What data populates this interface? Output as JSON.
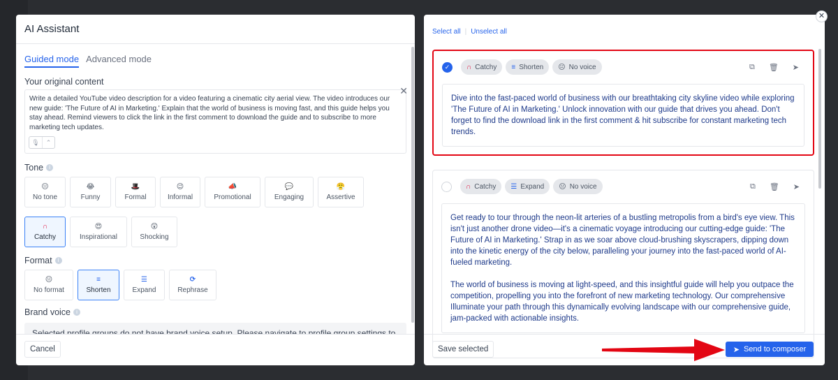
{
  "left": {
    "title": "AI Assistant",
    "modes": [
      "Guided mode",
      "Advanced mode"
    ],
    "original_label": "Your original content",
    "original_text": "Write a detailed YouTube video description for a video featuring a cinematic city aerial view. The video introduces our new guide: 'The Future of AI in Marketing.' Explain that the world of business is moving fast, and this guide helps you stay ahead. Remind viewers to click the link in the first comment to download the guide and to subscribe to more marketing tech updates.",
    "tone_label": "Tone",
    "tones": [
      {
        "label": "No tone",
        "icon": "😐"
      },
      {
        "label": "Funny",
        "icon": "😂"
      },
      {
        "label": "Formal",
        "icon": "🎩"
      },
      {
        "label": "Informal",
        "icon": "😉"
      },
      {
        "label": "Promotional",
        "icon": "📣"
      },
      {
        "label": "Engaging",
        "icon": "💬"
      },
      {
        "label": "Assertive",
        "icon": "😤"
      },
      {
        "label": "Catchy",
        "icon": "∩"
      },
      {
        "label": "Inspirational",
        "icon": "😍"
      },
      {
        "label": "Shocking",
        "icon": "😲"
      }
    ],
    "format_label": "Format",
    "formats": [
      {
        "label": "No format",
        "icon": "😐"
      },
      {
        "label": "Shorten",
        "icon": "≡"
      },
      {
        "label": "Expand",
        "icon": "☰"
      },
      {
        "label": "Rephrase",
        "icon": "⟳"
      }
    ],
    "brand_label": "Brand voice",
    "brand_note": "Selected profile groups do not have brand voice setup. Please navigate to profile group settings to",
    "cancel": "Cancel"
  },
  "right": {
    "select_all": "Select all",
    "unselect_all": "Unselect all",
    "cards": [
      {
        "tags": [
          {
            "label": "Catchy",
            "icon": "∩"
          },
          {
            "label": "Shorten",
            "icon": "≡"
          },
          {
            "label": "No voice",
            "icon": "😐"
          }
        ],
        "paragraphs": [
          "Dive into the fast-paced world of business with our breathtaking city skyline video while exploring 'The Future of AI in Marketing.' Unlock innovation with our guide that drives you ahead. Don't forget to find the download link in the first comment & hit subscribe for constant marketing tech trends."
        ]
      },
      {
        "tags": [
          {
            "label": "Catchy",
            "icon": "∩"
          },
          {
            "label": "Expand",
            "icon": "☰"
          },
          {
            "label": "No voice",
            "icon": "😐"
          }
        ],
        "paragraphs": [
          "Get ready to tour through the neon-lit arteries of a bustling metropolis from a bird's eye view. This isn't just another drone video—it's a cinematic voyage introducing our cutting-edge guide: 'The Future of AI in Marketing.' Strap in as we soar above cloud-brushing skyscrapers, dipping down into the kinetic energy of the city below, paralleling your journey into the fast-paced world of AI-fueled marketing.",
          "The world of business is moving at light-speed, and this insightful guide will help you outpace the competition, propelling you into the forefront of new marketing technology. Our comprehensive Illuminate your path through this dynamically evolving landscape with our comprehensive guide, jam-packed with actionable insights."
        ]
      }
    ],
    "save_selected": "Save selected",
    "send": "Send to composer"
  },
  "colors": {
    "accent": "#2563eb",
    "highlight": "#e30613"
  }
}
